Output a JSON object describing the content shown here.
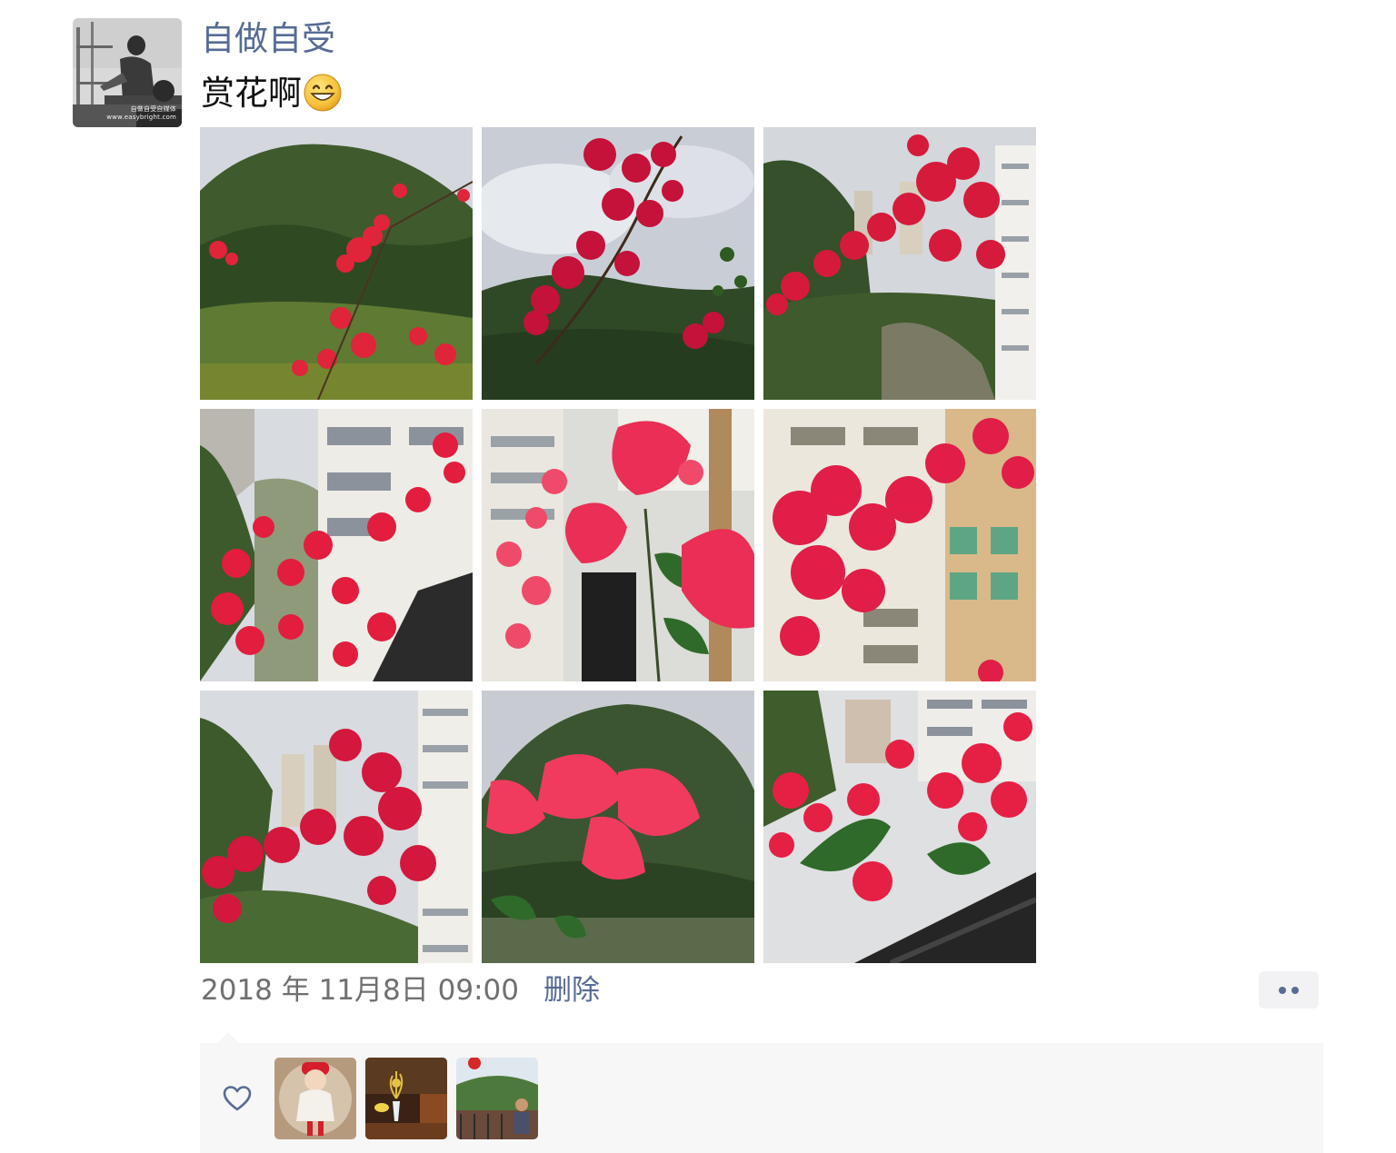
{
  "post": {
    "author": {
      "name": "自做自受",
      "avatar_caption_line1": "自做自受自媒体",
      "avatar_caption_line2": "www.easybright.com"
    },
    "text": "赏花啊",
    "emoji": "grinning-face-icon",
    "photos": [
      {
        "name": "photo-1",
        "subject": "bougainvillea-hill"
      },
      {
        "name": "photo-2",
        "subject": "bougainvillea-sky"
      },
      {
        "name": "photo-3",
        "subject": "bougainvillea-buildings"
      },
      {
        "name": "photo-4",
        "subject": "bougainvillea-balcony"
      },
      {
        "name": "photo-5",
        "subject": "bougainvillea-closeup"
      },
      {
        "name": "photo-6",
        "subject": "bougainvillea-apartment"
      },
      {
        "name": "photo-7",
        "subject": "bougainvillea-tower"
      },
      {
        "name": "photo-8",
        "subject": "bougainvillea-hill-closeup"
      },
      {
        "name": "photo-9",
        "subject": "bougainvillea-railing"
      }
    ],
    "timestamp": "2018 年 11月8日 09:00",
    "delete_label": "删除",
    "more_icon": "more-dots-icon"
  },
  "likes": {
    "icon": "heart-outline-icon",
    "users": [
      {
        "name": "liker-avatar-1"
      },
      {
        "name": "liker-avatar-2"
      },
      {
        "name": "liker-avatar-3"
      }
    ]
  },
  "colors": {
    "link": "#576b95",
    "text": "#111111",
    "meta": "#707070",
    "likes_bg": "#f7f7f7",
    "more_bg": "#f2f2f4"
  }
}
